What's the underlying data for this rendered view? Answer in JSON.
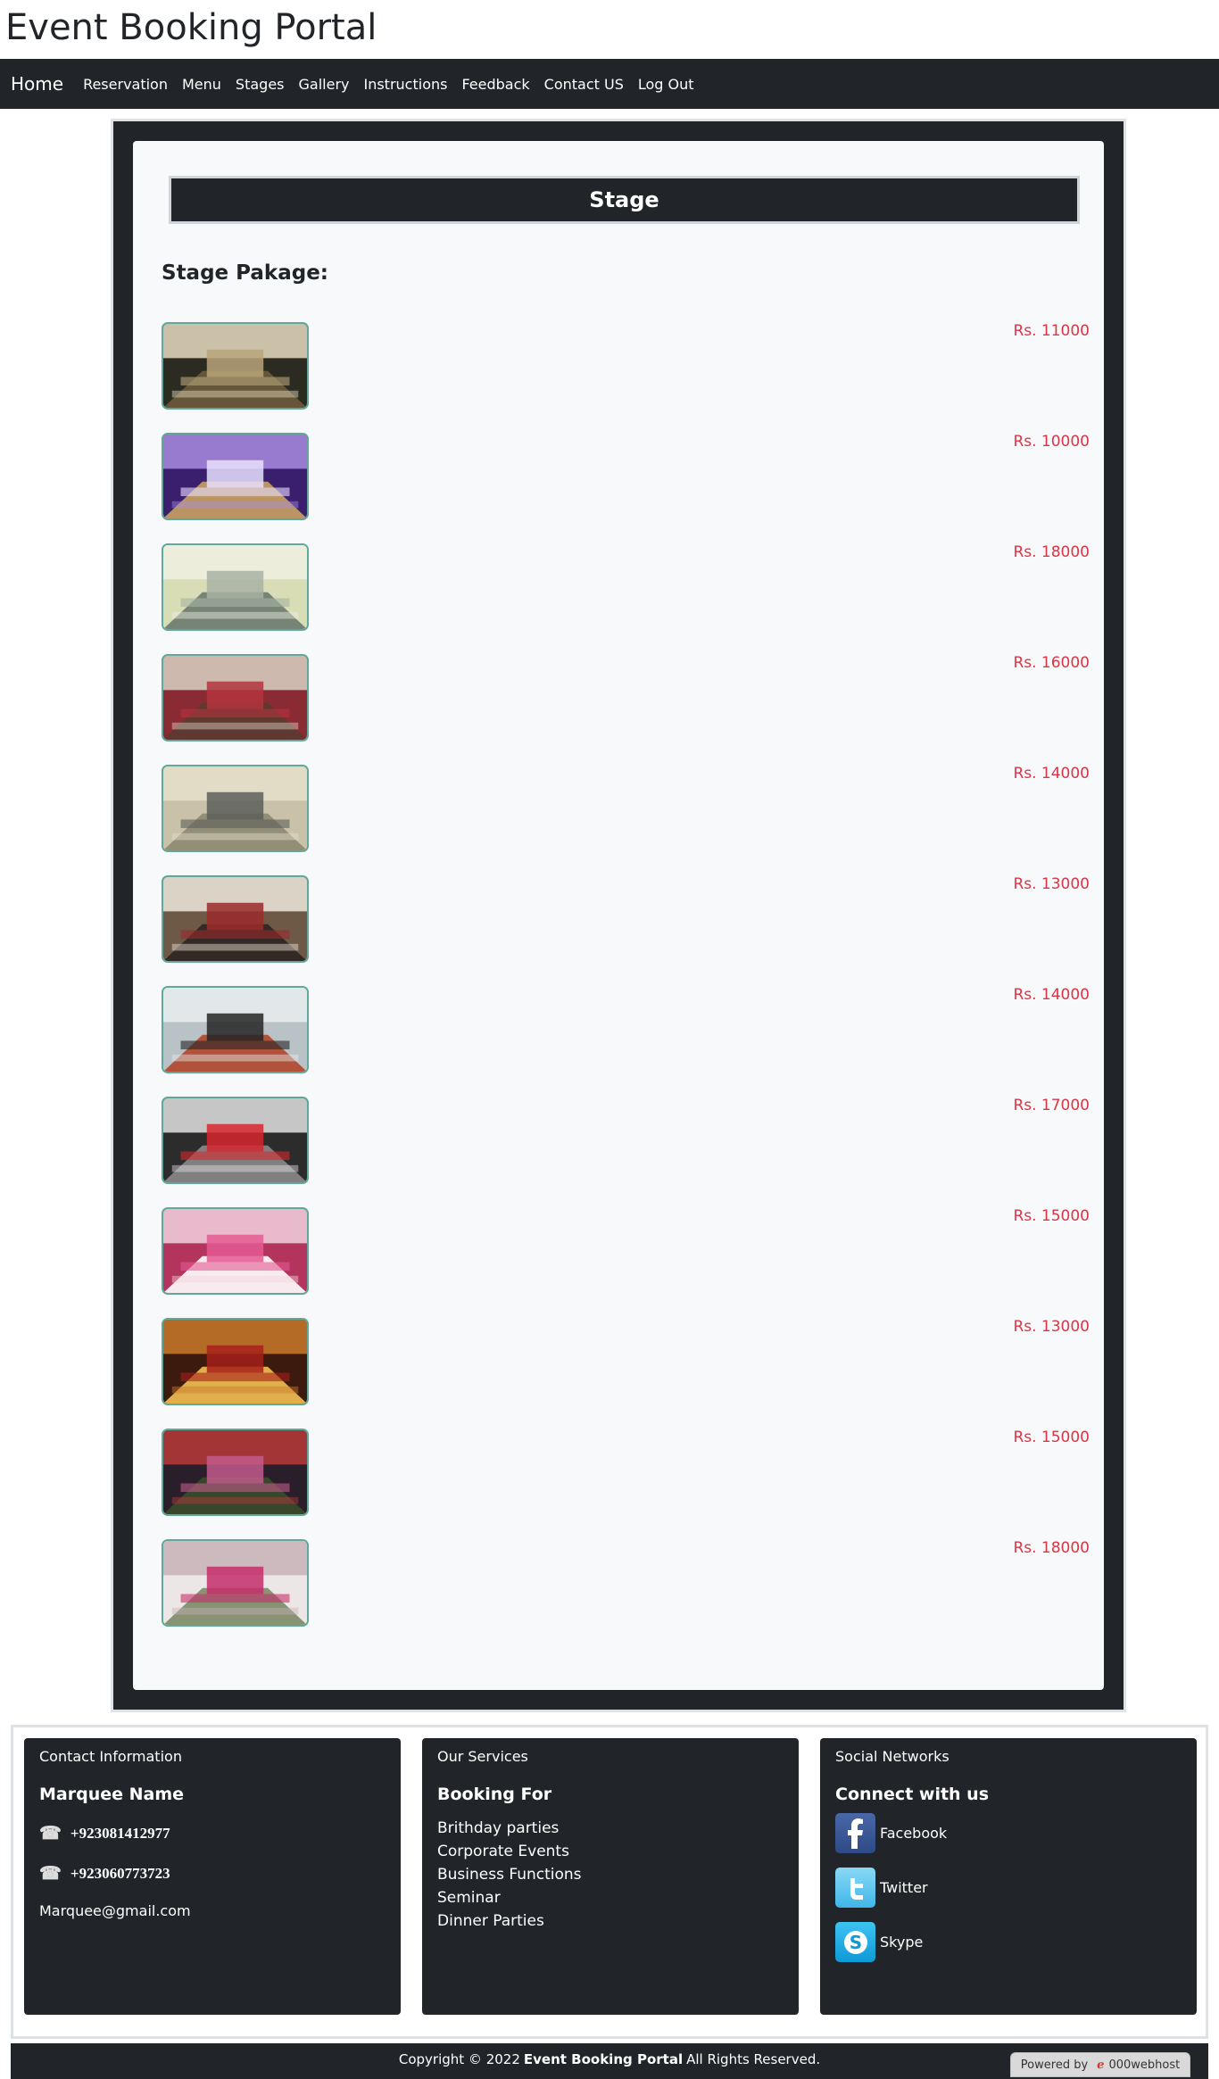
{
  "site": {
    "title": "Event Booking Portal"
  },
  "nav": {
    "brand": "Home",
    "items": [
      "Reservation",
      "Menu",
      "Stages",
      "Gallery",
      "Instructions",
      "Feedback",
      "Contact US",
      "Log Out"
    ]
  },
  "stage": {
    "header": "Stage",
    "package_heading": "Stage Pakage:",
    "packages": [
      {
        "price": "Rs. 11000",
        "scene": "white-drape-stage"
      },
      {
        "price": "Rs. 10000",
        "scene": "purple-wedding-stage"
      },
      {
        "price": "Rs. 18000",
        "scene": "seminar-hall"
      },
      {
        "price": "Rs. 16000",
        "scene": "red-chair-hall"
      },
      {
        "price": "Rs. 14000",
        "scene": "banquet-tables-hall"
      },
      {
        "price": "Rs. 13000",
        "scene": "conference-room"
      },
      {
        "price": "Rs. 14000",
        "scene": "boardroom"
      },
      {
        "price": "Rs. 17000",
        "scene": "red-banquet-hall"
      },
      {
        "price": "Rs. 15000",
        "scene": "pink-event-hall"
      },
      {
        "price": "Rs. 13000",
        "scene": "red-carpet-stage"
      },
      {
        "price": "Rs. 15000",
        "scene": "floral-aisle-stage"
      },
      {
        "price": "Rs. 18000",
        "scene": "floral-canopy-stage"
      }
    ]
  },
  "footer": {
    "contact": {
      "heading": "Contact Information",
      "title": "Marquee Name",
      "phone1": "+923081412977",
      "phone2": "+923060773723",
      "email": "Marquee@gmail.com",
      "phone_icon": "telephone-icon"
    },
    "services": {
      "heading": "Our Services",
      "title": "Booking For",
      "items": [
        "Brithday parties",
        "Corporate Events",
        "Business Functions",
        "Seminar",
        "Dinner Parties"
      ]
    },
    "social": {
      "heading": "Social Networks",
      "title": "Connect with us",
      "links": [
        {
          "label": "Facebook",
          "icon": "facebook-icon",
          "color": "#3b5998"
        },
        {
          "label": "Twitter",
          "icon": "twitter-icon",
          "color": "#55c5f0"
        },
        {
          "label": "Skype",
          "icon": "skype-icon",
          "color": "#16a9e8"
        }
      ]
    }
  },
  "copyright": {
    "prefix": "Copyright © 2022",
    "brand": "Event Booking Portal",
    "suffix": "All Rights Reserved."
  },
  "powered_by": {
    "label": "Powered by",
    "host": "000webhost"
  },
  "colors": {
    "dark": "#212529",
    "light": "#f8f9fa",
    "price": "#dc3545",
    "border": "#dee2e6"
  }
}
